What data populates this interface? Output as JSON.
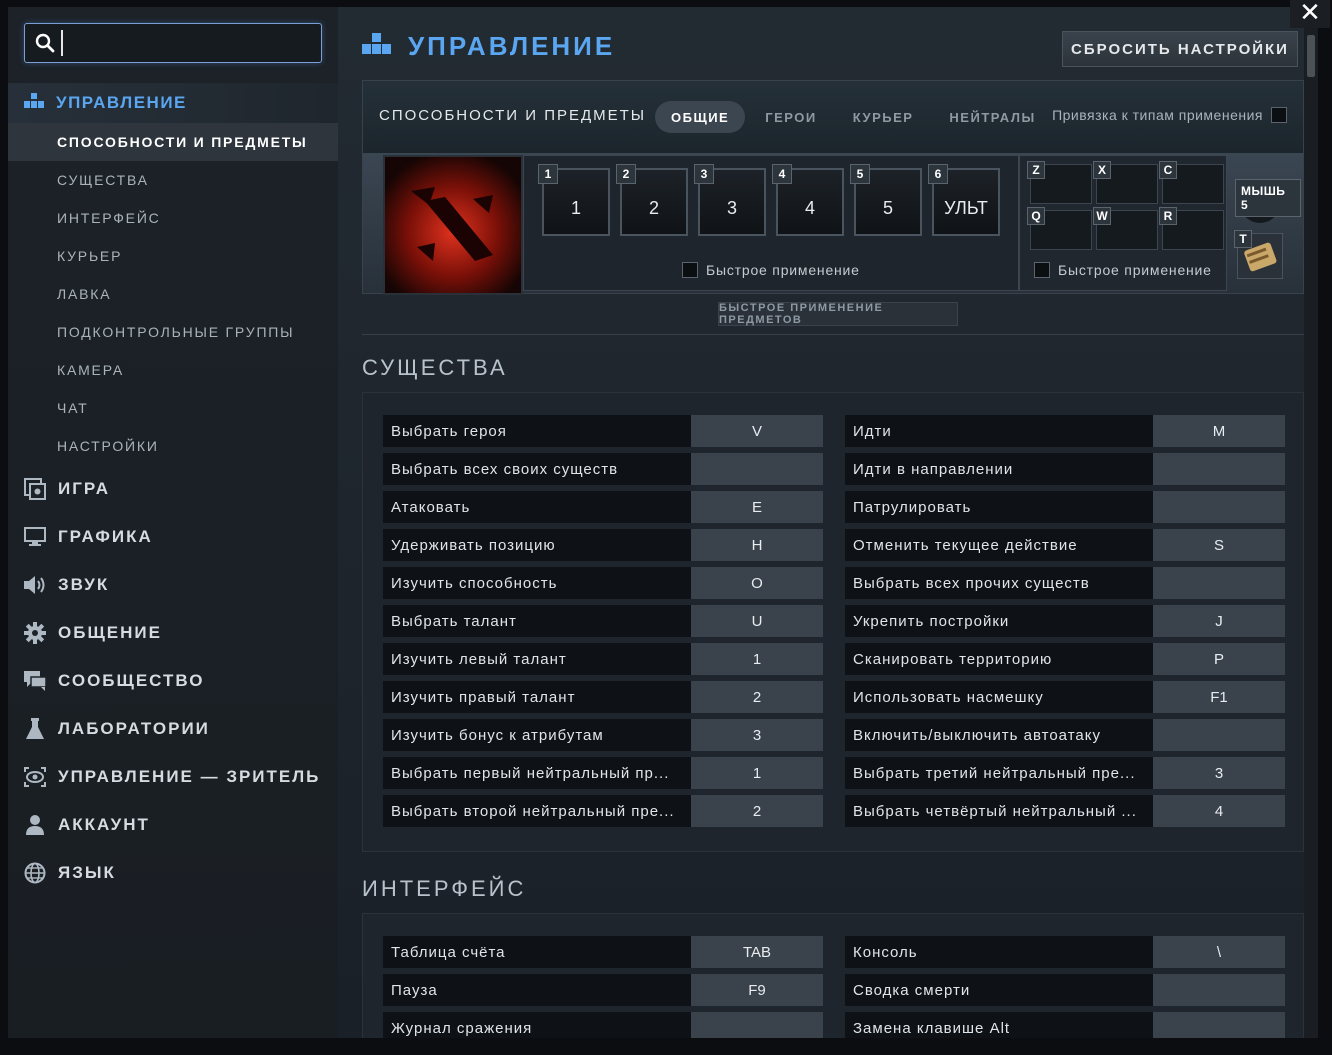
{
  "window": {
    "close_glyph": "✕"
  },
  "search": {
    "value": "",
    "placeholder": ""
  },
  "sidebar": {
    "top": {
      "label": "УПРАВЛЕНИЕ",
      "icon": "controls-icon"
    },
    "subitems": [
      {
        "label": "СПОСОБНОСТИ И ПРЕДМЕТЫ",
        "active": true
      },
      {
        "label": "СУЩЕСТВА"
      },
      {
        "label": "ИНТЕРФЕЙС"
      },
      {
        "label": "КУРЬЕР"
      },
      {
        "label": "ЛАВКА"
      },
      {
        "label": "ПОДКОНТРОЛЬНЫЕ ГРУППЫ"
      },
      {
        "label": "КАМЕРА"
      },
      {
        "label": "ЧАТ"
      },
      {
        "label": "НАСТРОЙКИ"
      }
    ],
    "categories": [
      {
        "label": "ИГРА",
        "icon": "game-icon"
      },
      {
        "label": "ГРАФИКА",
        "icon": "monitor-icon"
      },
      {
        "label": "ЗВУК",
        "icon": "speaker-icon"
      },
      {
        "label": "ОБЩЕНИЕ",
        "icon": "gear-icon"
      },
      {
        "label": "СООБЩЕСТВО",
        "icon": "chat-icon"
      },
      {
        "label": "ЛАБОРАТОРИИ",
        "icon": "flask-icon"
      },
      {
        "label": "УПРАВЛЕНИЕ — ЗРИТЕЛЬ",
        "icon": "camera-icon"
      },
      {
        "label": "АККАУНТ",
        "icon": "user-icon"
      },
      {
        "label": "ЯЗЫК",
        "icon": "globe-icon"
      }
    ]
  },
  "header": {
    "title": "УПРАВЛЕНИЕ",
    "reset_label": "СБРОСИТЬ НАСТРОЙКИ"
  },
  "abilities_panel": {
    "title": "СПОСОБНОСТИ И ПРЕДМЕТЫ",
    "tabs": [
      {
        "label": "ОБЩИЕ",
        "active": true
      },
      {
        "label": "ГЕРОИ"
      },
      {
        "label": "КУРЬЕР"
      },
      {
        "label": "НЕЙТРАЛЫ"
      }
    ],
    "bind_type_label": "Привязка к типам применения",
    "abilities": [
      {
        "num": "1",
        "key": "1"
      },
      {
        "num": "2",
        "key": "2"
      },
      {
        "num": "3",
        "key": "3"
      },
      {
        "num": "4",
        "key": "4"
      },
      {
        "num": "5",
        "key": "5"
      },
      {
        "num": "6",
        "key": "УЛЬТ"
      }
    ],
    "abilities_quickcast": "Быстрое применение",
    "items": [
      "Z",
      "X",
      "C",
      "Q",
      "W",
      "R"
    ],
    "items_quickcast": "Быстрое применение",
    "mouse_label": "МЫШЬ 5",
    "tp_key": "T",
    "quick_items_button": "БЫСТРОЕ ПРИМЕНЕНИЕ ПРЕДМЕТОВ"
  },
  "units_section": {
    "title": "СУЩЕСТВА",
    "left": [
      {
        "name": "Выбрать героя",
        "key": "V"
      },
      {
        "name": "Выбрать всех своих существ",
        "key": ""
      },
      {
        "name": "Атаковать",
        "key": "E"
      },
      {
        "name": "Удерживать позицию",
        "key": "H"
      },
      {
        "name": "Изучить способность",
        "key": "O"
      },
      {
        "name": "Выбрать талант",
        "key": "U"
      },
      {
        "name": "Изучить левый талант",
        "key": "1"
      },
      {
        "name": "Изучить правый талант",
        "key": "2"
      },
      {
        "name": "Изучить бонус к атрибутам",
        "key": "3"
      },
      {
        "name": "Выбрать первый нейтральный пр...",
        "key": "1"
      },
      {
        "name": "Выбрать второй нейтральный пре...",
        "key": "2"
      }
    ],
    "right": [
      {
        "name": "Идти",
        "key": "M"
      },
      {
        "name": "Идти в направлении",
        "key": ""
      },
      {
        "name": "Патрулировать",
        "key": ""
      },
      {
        "name": "Отменить текущее действие",
        "key": "S"
      },
      {
        "name": "Выбрать всех прочих существ",
        "key": ""
      },
      {
        "name": "Укрепить постройки",
        "key": "J"
      },
      {
        "name": "Сканировать территорию",
        "key": "P"
      },
      {
        "name": "Использовать насмешку",
        "key": "F1"
      },
      {
        "name": "Включить/выключить автоатаку",
        "key": ""
      },
      {
        "name": "Выбрать третий нейтральный пре...",
        "key": "3"
      },
      {
        "name": "Выбрать четвёртый нейтральный ...",
        "key": "4"
      }
    ]
  },
  "interface_section": {
    "title": "ИНТЕРФЕЙС",
    "left": [
      {
        "name": "Таблица счёта",
        "key": "TAB"
      },
      {
        "name": "Пауза",
        "key": "F9"
      },
      {
        "name": "Журнал сражения",
        "key": ""
      }
    ],
    "right": [
      {
        "name": "Консоль",
        "key": "\\"
      },
      {
        "name": "Сводка смерти",
        "key": ""
      },
      {
        "name": "Замена клавише Alt",
        "key": ""
      }
    ]
  }
}
